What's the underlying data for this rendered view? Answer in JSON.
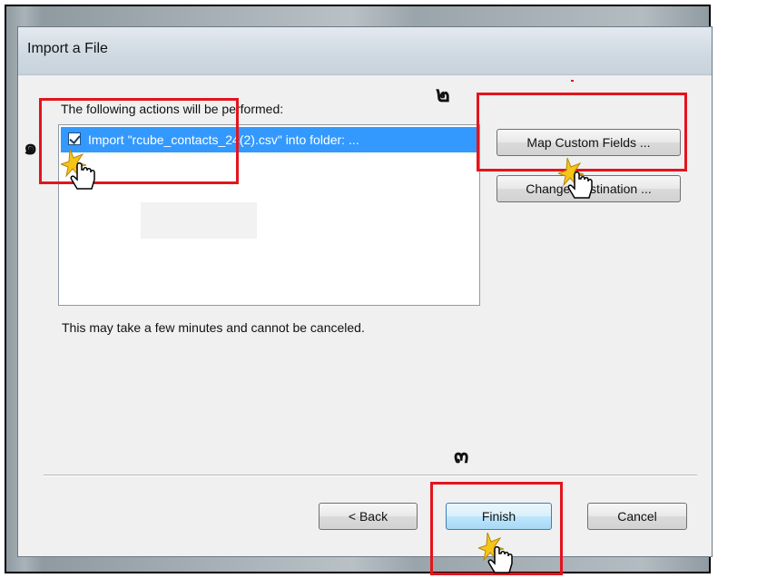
{
  "window": {
    "title": "Import a File"
  },
  "actions_label": "The following actions will be performed:",
  "actions": [
    {
      "label": "Import \"rcube_contacts_24(2).csv\" into folder: ...",
      "checked": true
    }
  ],
  "buttons": {
    "map_custom_fields": "Map Custom Fields ...",
    "change_destination": "Change Destination ...",
    "back": "< Back",
    "finish": "Finish",
    "cancel": "Cancel"
  },
  "note": "This may take a few minutes and cannot be canceled.",
  "steps": {
    "one": "๑",
    "two": "๒",
    "three": "๓"
  },
  "colors": {
    "highlight_box": "#e3141d",
    "selection": "#3399ff",
    "cursor_spark": "#f5c518"
  },
  "icons": [
    "hand-cursor-icon",
    "checkbox-icon"
  ]
}
